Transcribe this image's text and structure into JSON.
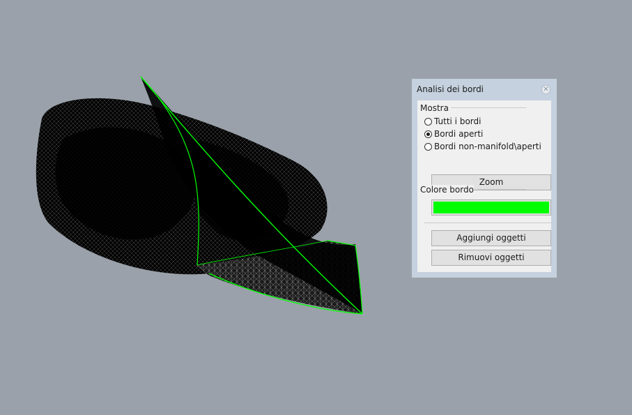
{
  "viewport": {
    "background": "#9aa1aa",
    "edge_color": "#00ff00",
    "mesh_color": "#000000"
  },
  "panel": {
    "title": "Analisi dei bordi",
    "close_icon": "close-icon",
    "show_group": {
      "label": "Mostra",
      "options": [
        {
          "label": "Tutti i bordi",
          "checked": false
        },
        {
          "label": "Bordi aperti",
          "checked": true
        },
        {
          "label": "Bordi non-manifold\\aperti",
          "checked": false
        }
      ]
    },
    "zoom_label": "Zoom",
    "color_group": {
      "label": "Colore bordo",
      "color": "#00ff00"
    },
    "add_objects_label": "Aggiungi oggetti",
    "remove_objects_label": "Rimuovi oggetti"
  }
}
